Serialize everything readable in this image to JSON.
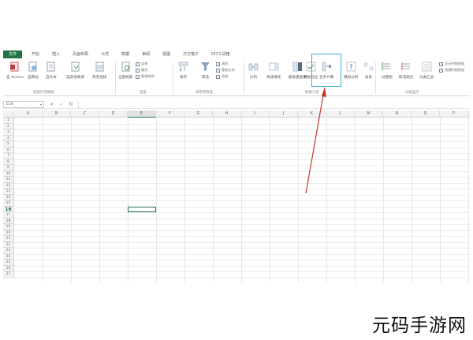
{
  "ribbon_tabs": [
    "文件",
    "开始",
    "插入",
    "页面布局",
    "公式",
    "数据",
    "审阅",
    "视图",
    "方方格子",
    "DIY工具箱"
  ],
  "ribbon": {
    "get_external": {
      "buttons": [
        "自 Access",
        "自网站",
        "自文本",
        "自其他来源",
        "现有连接"
      ],
      "label": "获取外部数据"
    },
    "connections": {
      "refresh": "全部刷新",
      "small": [
        "连接",
        "属性",
        "编辑链接"
      ],
      "label": "连接"
    },
    "sort_filter": {
      "sort": "排序",
      "filter": "筛选",
      "small": [
        "清除",
        "重新应用",
        "高级"
      ],
      "label": "排序和筛选"
    },
    "data_tools": {
      "buttons": [
        "分列",
        "快速填充",
        "删除重复项",
        "数据验证",
        "合并计算",
        "模拟分析"
      ],
      "label": "数据工具"
    },
    "outline": {
      "buttons": [
        "关系",
        "创建组",
        "取消组合",
        "分类汇总"
      ],
      "small": [
        "显示明细数据",
        "隐藏明细数据"
      ],
      "label": "分级显示"
    },
    "tooltip_hint": "合并计算"
  },
  "formula_bar": {
    "name_box": "E16",
    "fx": "fx"
  },
  "grid": {
    "columns": [
      "A",
      "B",
      "C",
      "D",
      "E",
      "F",
      "G",
      "H",
      "I",
      "J",
      "K",
      "L",
      "M",
      "N",
      "O",
      "P"
    ],
    "active_column": "E",
    "rows": [
      "1",
      "2",
      "3",
      "4",
      "5",
      "6",
      "7",
      "8",
      "9",
      "10",
      "11",
      "12",
      "13",
      "14",
      "15",
      "16",
      "17",
      "18",
      "19",
      "20",
      "21",
      "22",
      "23",
      "24",
      "25",
      "26",
      "27"
    ],
    "active_row": "16"
  },
  "watermark": "元码手游网",
  "colors": {
    "accent": "#217346",
    "highlight_box": "#3aa9d9",
    "arrow": "#c0392b"
  }
}
